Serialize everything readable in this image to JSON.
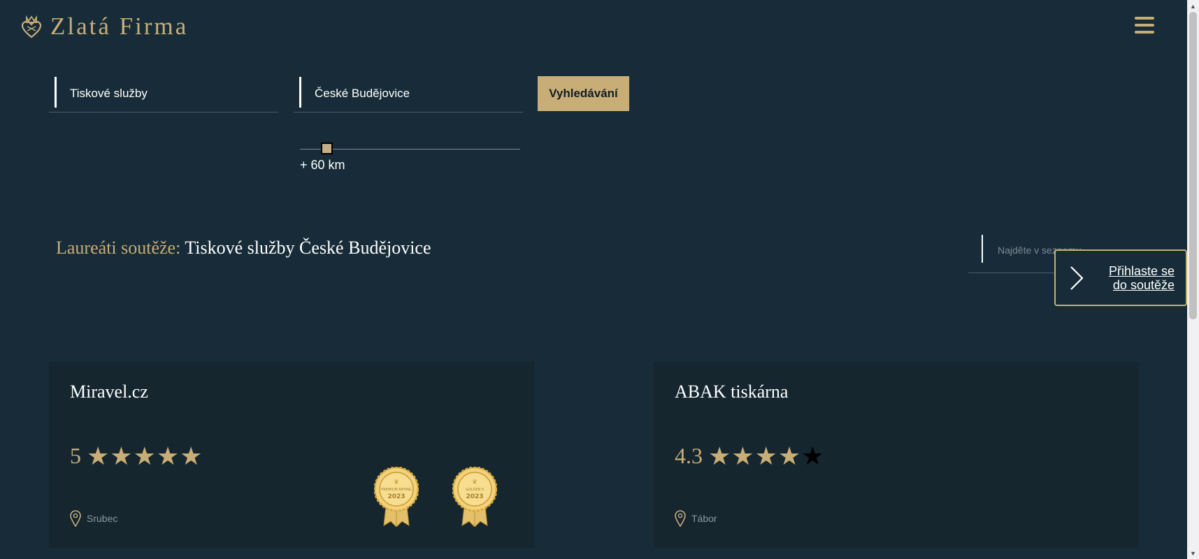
{
  "brand": {
    "name": "Zlatá Firma",
    "accent": "#c8ad76",
    "background": "#172c38",
    "card_background": "#15262f"
  },
  "search": {
    "category_value": "Tiskové služby",
    "location_value": "České Budějovice",
    "button_label": "Vyhledávání",
    "radius_label": "+ 60 km",
    "radius_km": 60
  },
  "section": {
    "label": "Laureáti soutěže:",
    "query": "Tiskové služby České Budějovice",
    "list_search_placeholder": "Najděte v seznamu"
  },
  "cta": {
    "line1": "Přihlaste se",
    "line2": "do soutěže"
  },
  "companies": [
    {
      "name": "Miravel.cz",
      "rating": "5",
      "rating_value": 5,
      "location": "Srubec",
      "badges": [
        {
          "top": "PREMIUM RATING",
          "year": "2023"
        },
        {
          "top": "GOLDEN 5",
          "year": "2023"
        }
      ]
    },
    {
      "name": "ABAK tiskárna",
      "rating": "4.3",
      "rating_value": 4.3,
      "location": "Tábor",
      "badges": []
    }
  ]
}
